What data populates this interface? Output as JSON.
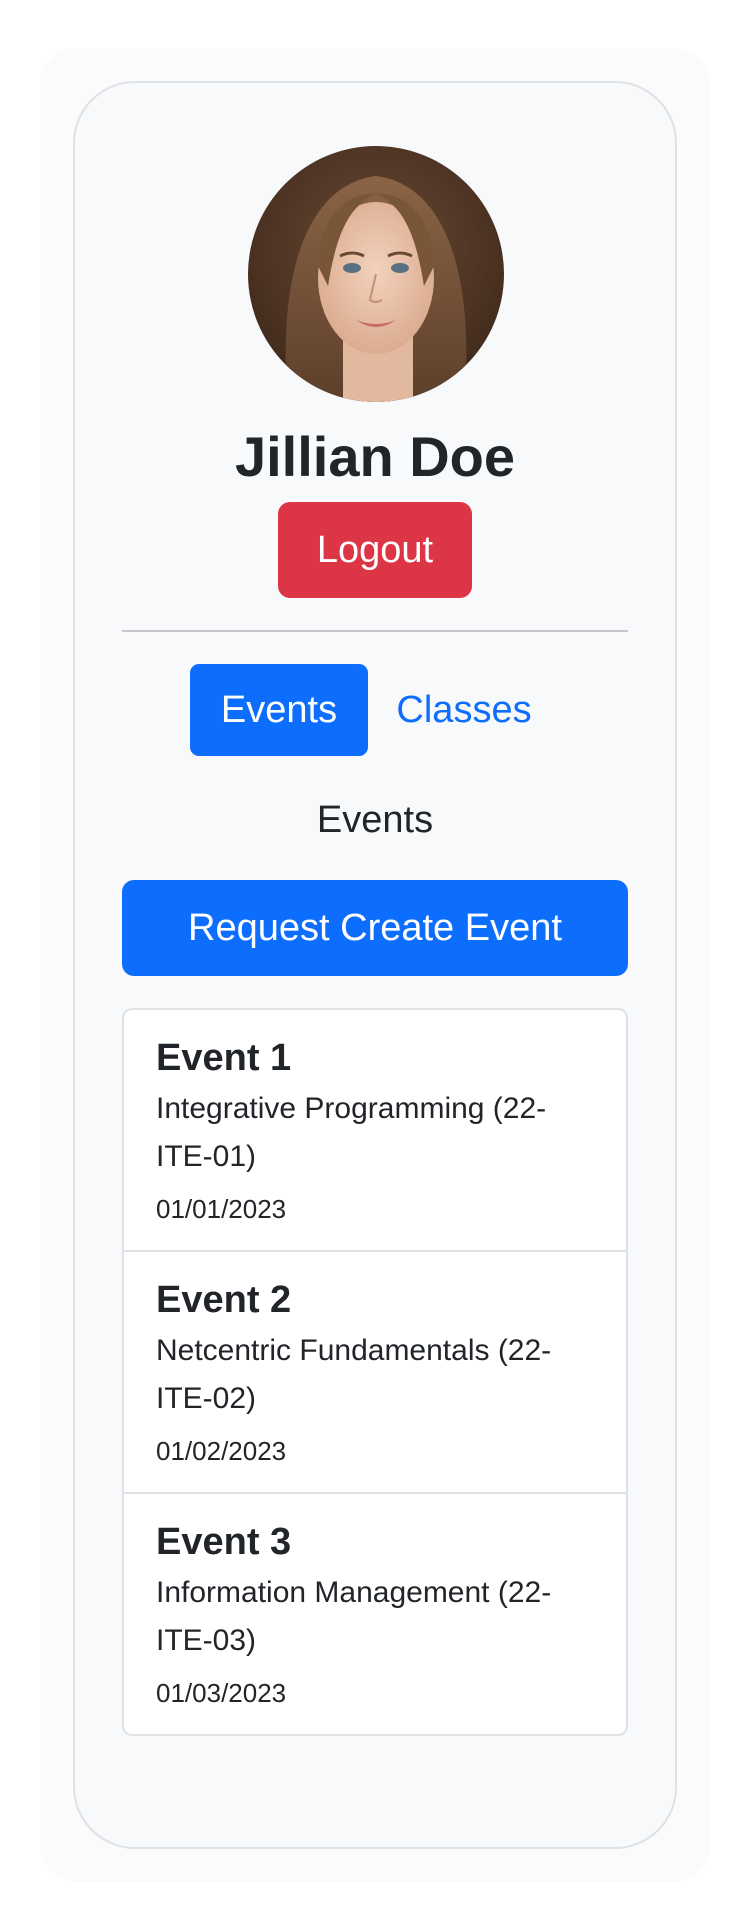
{
  "profile": {
    "name": "Jillian Doe",
    "logout_label": "Logout"
  },
  "tabs": [
    {
      "label": "Events",
      "active": true
    },
    {
      "label": "Classes",
      "active": false
    }
  ],
  "section_title": "Events",
  "request_button_label": "Request Create Event",
  "events": [
    {
      "title": "Event 1",
      "class": "Integrative Programming (22-ITE-01)",
      "date": "01/01/2023"
    },
    {
      "title": "Event 2",
      "class": "Netcentric Fundamentals (22-ITE-02)",
      "date": "01/02/2023"
    },
    {
      "title": "Event 3",
      "class": "Information Management (22-ITE-03)",
      "date": "01/03/2023"
    }
  ],
  "colors": {
    "primary": "#0d6efd",
    "danger": "#dc3545",
    "card_bg": "#f8f9fa",
    "border": "#dee2e6"
  }
}
